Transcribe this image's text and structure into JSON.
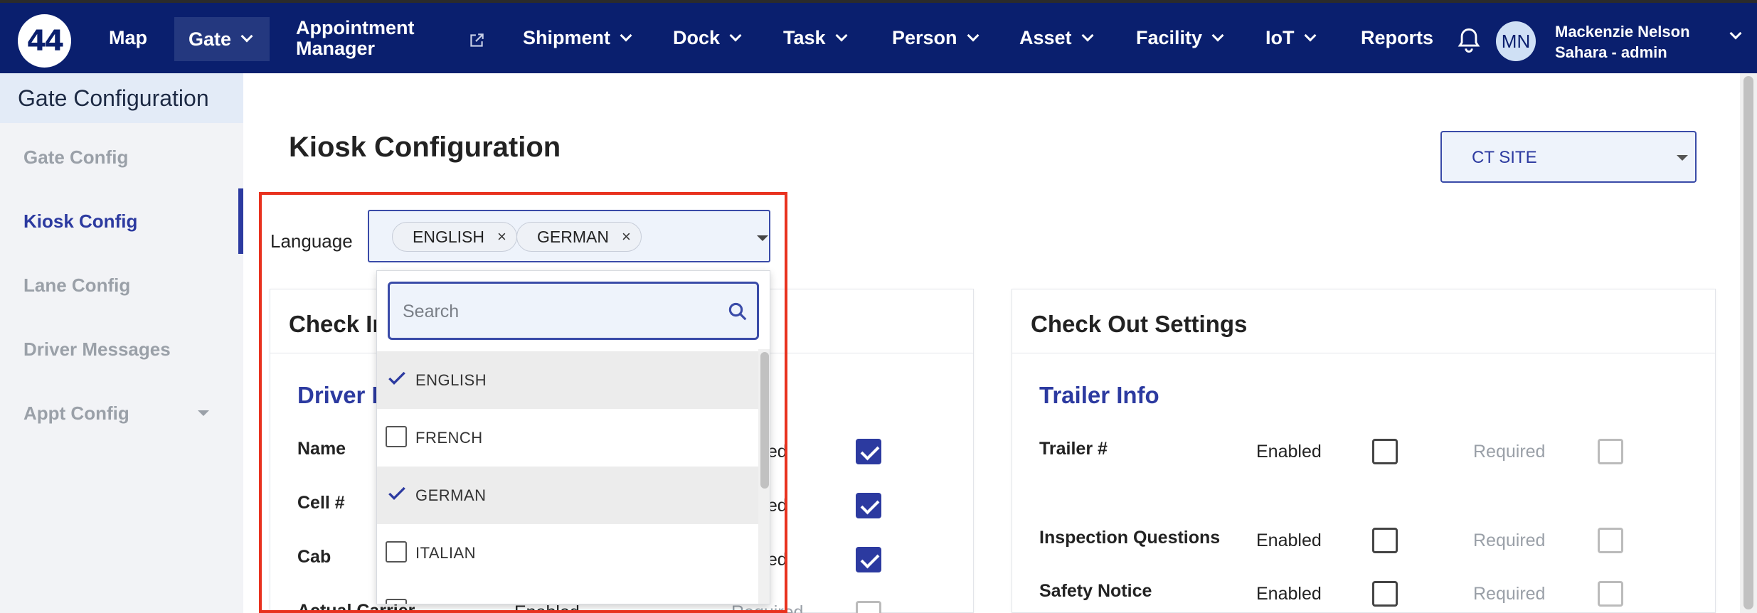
{
  "nav": {
    "logo_text": "44",
    "items": [
      "Map",
      "Gate",
      "Appointment Manager",
      "Shipment",
      "Dock",
      "Task",
      "Person",
      "Asset",
      "Facility",
      "IoT",
      "Reports"
    ],
    "appointment_line1": "Appointment",
    "appointment_line2": "Manager",
    "user_initials": "MN",
    "user_name": "Mackenzie Nelson",
    "user_role": "Sahara - admin",
    "brand_color": "#0a1f6e"
  },
  "sidebar": {
    "title": "Gate Configuration",
    "items": [
      "Gate Config",
      "Kiosk Config",
      "Lane Config",
      "Driver Messages",
      "Appt Config"
    ],
    "active": "Kiosk Config"
  },
  "main": {
    "title": "Kiosk Configuration",
    "site_select": "CT SITE",
    "language_label": "Language",
    "chips": [
      "ENGLISH",
      "GERMAN"
    ],
    "chip_remove": "×"
  },
  "dropdown": {
    "search_placeholder": "Search",
    "options": [
      {
        "label": "ENGLISH",
        "selected": true
      },
      {
        "label": "FRENCH",
        "selected": false
      },
      {
        "label": "GERMAN",
        "selected": true
      },
      {
        "label": "ITALIAN",
        "selected": false
      }
    ]
  },
  "check_in": {
    "title_partial": "Check In",
    "section_partial": "Driver In",
    "rows": [
      "Name",
      "Cell #",
      "Cab",
      "Actual Carrier"
    ],
    "required_partial": "ired",
    "enabled_partial": "Enabled",
    "required_label": "Required"
  },
  "check_out": {
    "title": "Check Out Settings",
    "section": "Trailer Info",
    "rows": [
      "Trailer #",
      "Inspection Questions",
      "Safety Notice"
    ],
    "enabled_label": "Enabled",
    "required_label": "Required"
  }
}
